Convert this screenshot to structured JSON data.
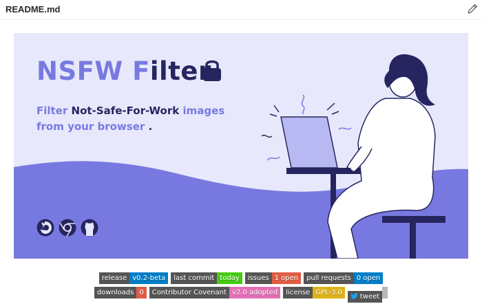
{
  "file": {
    "name": "README.md"
  },
  "banner": {
    "title_light": "NSFW F",
    "title_dark": "ilter",
    "tagline": {
      "w1": "Filter",
      "w2": "Not-Safe-For-Work",
      "w3": "images",
      "line2": "from your browser",
      "line2_end": " ."
    },
    "browser_icons": [
      "firefox-icon",
      "chrome-icon",
      "github-icon"
    ],
    "colors": {
      "background": "#e7e8fb",
      "accent": "#7879e0",
      "dark": "#27255f"
    }
  },
  "badges_row1": [
    {
      "label": "release",
      "value": "v0.2-beta",
      "color": "#007ec6"
    },
    {
      "label": "last commit",
      "value": "today",
      "color": "#44cc11"
    },
    {
      "label": "issues",
      "value": "1 open",
      "color": "#e05d44"
    },
    {
      "label": "pull requests",
      "value": "0 open",
      "color": "#007ec6"
    }
  ],
  "badges_row2": [
    {
      "label": "downloads",
      "value": "0",
      "color": "#e05d44"
    },
    {
      "label": "Contributor Covenant",
      "value": "v2.0 adopted",
      "color": "#e46fb6"
    },
    {
      "label": "license",
      "value": "GPL-3.0",
      "color": "#dfb317"
    },
    {
      "label": "tweet",
      "value": "",
      "color": "#b8b8b8"
    }
  ]
}
